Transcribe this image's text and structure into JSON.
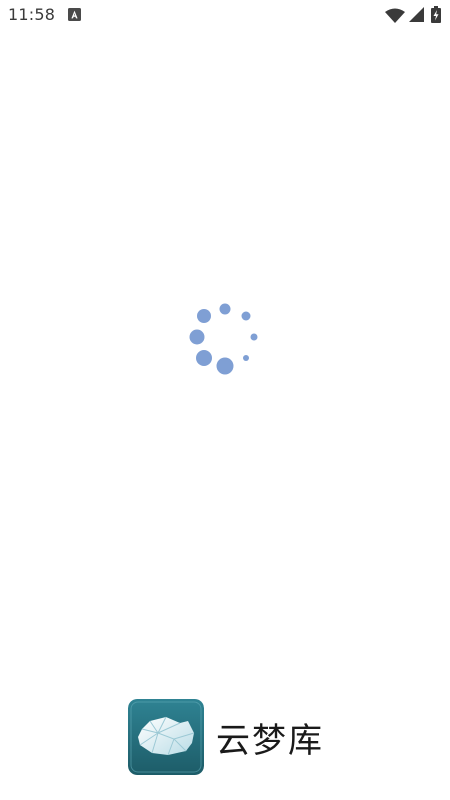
{
  "status_bar": {
    "time": "11:58",
    "icons": [
      "notification-a-icon",
      "wifi-icon",
      "cell-signal-icon",
      "battery-charging-icon"
    ]
  },
  "loading": {
    "icon": "loading-spinner-icon",
    "color": "#7f9fd4"
  },
  "branding": {
    "logo_icon": "cloud-logo-icon",
    "app_name": "云梦库",
    "logo_colors": [
      "#2f7f8e",
      "#1e5f6b"
    ]
  }
}
